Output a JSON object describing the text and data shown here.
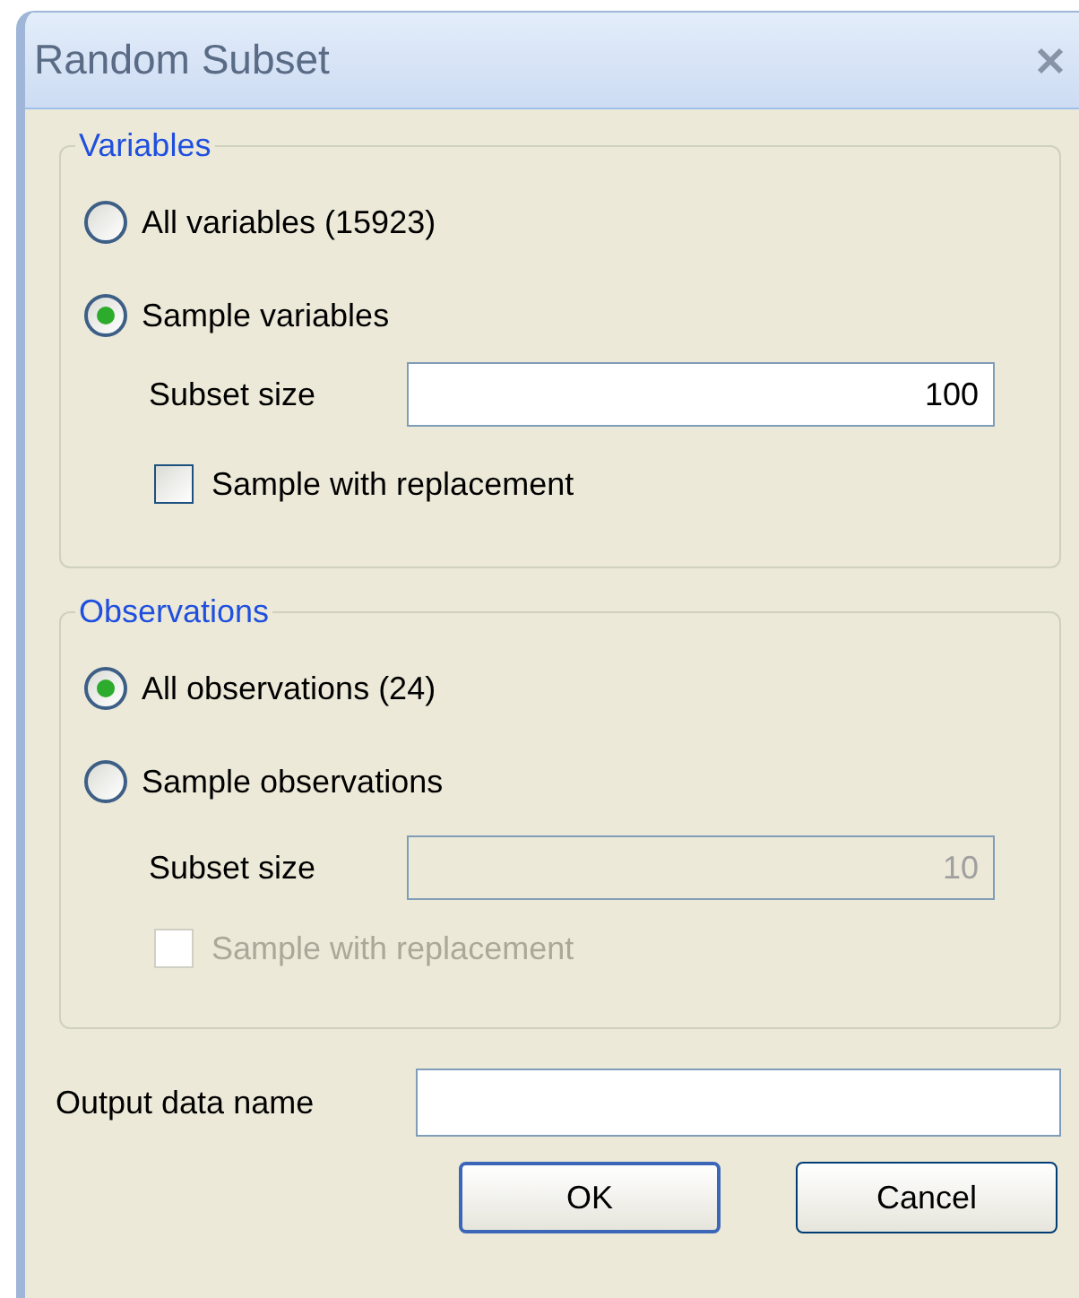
{
  "window": {
    "title": "Random Subset"
  },
  "groups": [
    {
      "title": "Variables",
      "options": [
        {
          "label": "All variables (15923)",
          "selected": false
        },
        {
          "label": "Sample variables",
          "selected": true
        }
      ],
      "subset": {
        "label": "Subset size",
        "value": "100",
        "disabled": false
      },
      "replacement": {
        "label": "Sample with replacement",
        "checked": false,
        "disabled": false
      }
    },
    {
      "title": "Observations",
      "options": [
        {
          "label": "All observations (24)",
          "selected": true
        },
        {
          "label": "Sample observations",
          "selected": false
        }
      ],
      "subset": {
        "label": "Subset size",
        "value": "10",
        "disabled": true
      },
      "replacement": {
        "label": "Sample with replacement",
        "checked": false,
        "disabled": true
      }
    }
  ],
  "output": {
    "label": "Output data name"
  },
  "buttons": [
    {
      "label": "OK",
      "default": true
    },
    {
      "label": "Cancel",
      "default": false
    }
  ]
}
